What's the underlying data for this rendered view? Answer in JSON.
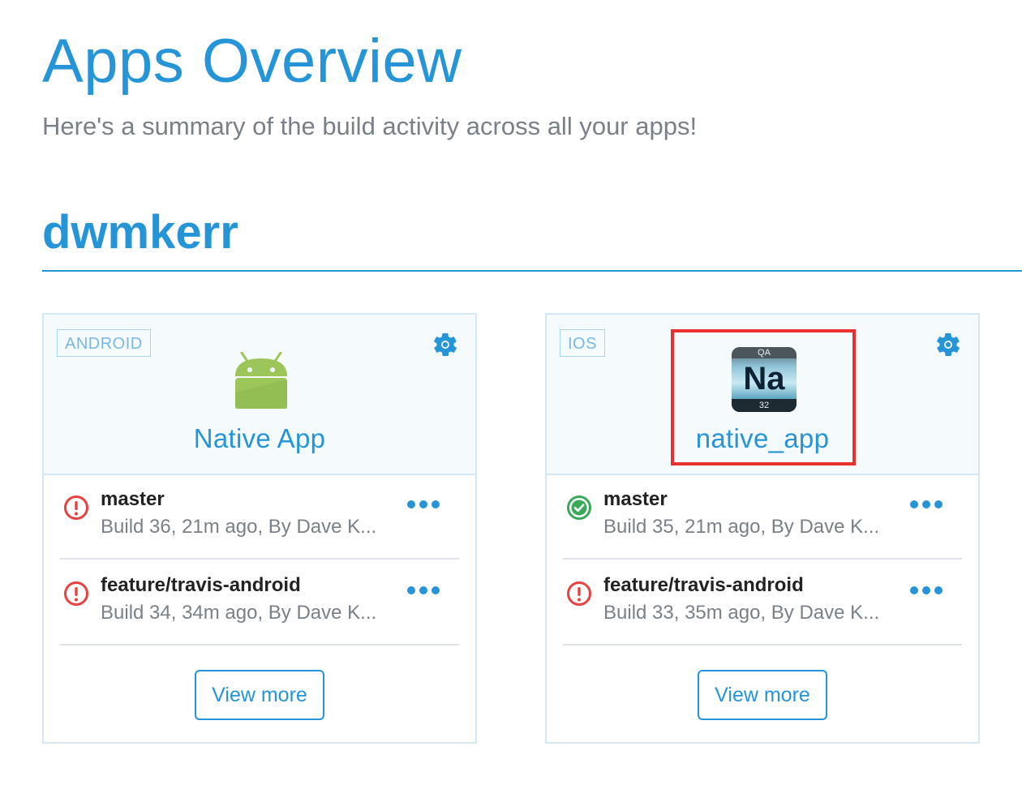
{
  "page": {
    "title": "Apps Overview",
    "subtitle": "Here's a summary of the build activity across all your apps!"
  },
  "owner": {
    "name": "dwmkerr"
  },
  "apps": [
    {
      "platform": "ANDROID",
      "name": "Native App",
      "icon": "android-robot-icon",
      "builds": [
        {
          "status": "failed",
          "branch": "master",
          "meta": "Build 36,  21m ago, By Dave K..."
        },
        {
          "status": "failed",
          "branch": "feature/travis-android",
          "meta": "Build 34,  34m ago, By Dave K..."
        }
      ],
      "view_more_label": "View more"
    },
    {
      "platform": "IOS",
      "name": "native_app",
      "icon": "element-tile-icon",
      "icon_text": {
        "top": "QA",
        "symbol": "Na",
        "bottom": "32"
      },
      "highlighted": true,
      "builds": [
        {
          "status": "success",
          "branch": "master",
          "meta": "Build 35,  21m ago, By Dave K..."
        },
        {
          "status": "failed",
          "branch": "feature/travis-android",
          "meta": "Build 33,  35m ago, By Dave K..."
        }
      ],
      "view_more_label": "View more"
    }
  ],
  "colors": {
    "accent": "#2595d8",
    "failed": "#e8413f",
    "success": "#3ba95a",
    "highlight": "#e8302d"
  }
}
